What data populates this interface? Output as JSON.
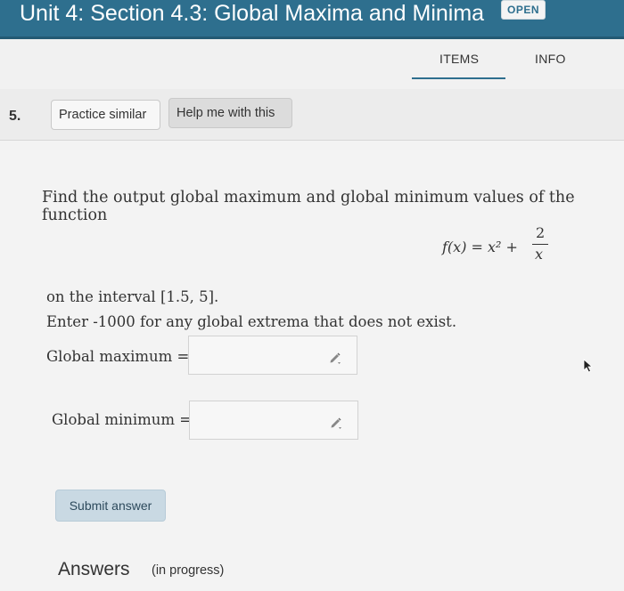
{
  "header": {
    "title": "Unit 4: Section 4.3: Global Maxima and Minima",
    "badge": "OPEN"
  },
  "tabs": [
    {
      "label": "ITEMS",
      "active": true
    },
    {
      "label": "INFO",
      "active": false
    }
  ],
  "question": {
    "number": "5.",
    "practice_label": "Practice similar",
    "help_label": "Help me with this",
    "prompt": "Find the output global maximum and global minimum values of the function",
    "formula": {
      "lhs": "f(x) = x² +",
      "numerator": "2",
      "denominator": "x"
    },
    "interval_text": "on the interval [1.5, 5].",
    "instruction": "Enter -1000 for any global extrema that does not exist.",
    "max_label": "Global maximum =",
    "max_value": "",
    "min_label": "Global minimum =",
    "min_value": "",
    "submit_label": "Submit answer"
  },
  "answers": {
    "heading": "Answers",
    "status": "(in progress)"
  },
  "icons": {
    "pencil": "pencil-icon",
    "cursor": "mouse-pointer-icon"
  },
  "colors": {
    "header_bg": "#2e6f8e",
    "accent": "#2e6f8e",
    "submit_bg": "#c9d9e3"
  }
}
